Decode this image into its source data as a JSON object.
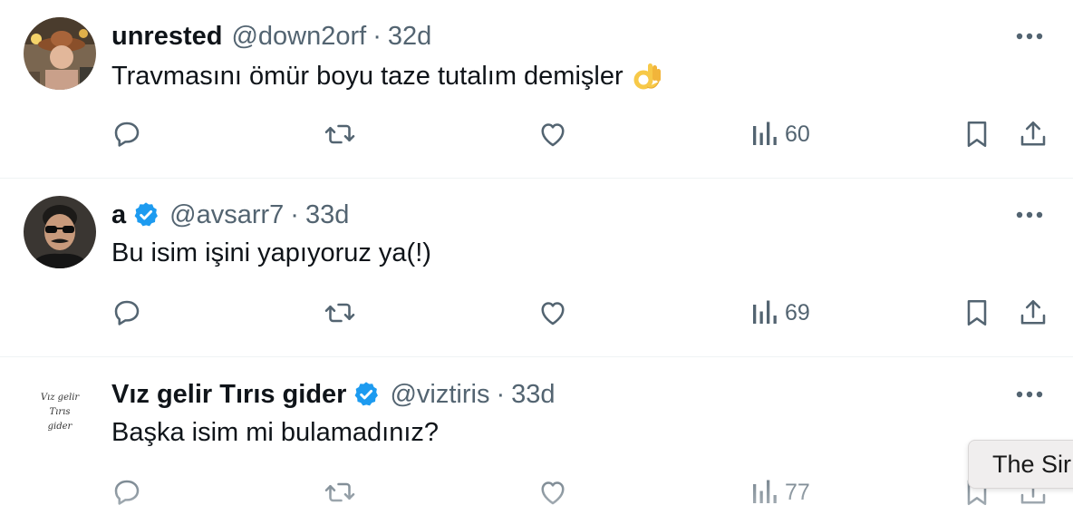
{
  "colors": {
    "text_primary": "#0f1419",
    "text_secondary": "#536471",
    "verified_blue": "#1d9bf0",
    "divider": "#eff3f4"
  },
  "tweets": [
    {
      "name": "unrested",
      "handle": "@down2orf",
      "separator": "·",
      "time": "32d",
      "text": "Travmasını ömür boyu taze tutalım demişler",
      "emoji": "ok-hand-emoji",
      "verified": false,
      "views": "60"
    },
    {
      "name": "a",
      "handle": "@avsarr7",
      "separator": "·",
      "time": "33d",
      "text": "Bu isim işini yapıyoruz ya(!)",
      "verified": true,
      "views": "69"
    },
    {
      "name": "Vız gelir Tırıs gider",
      "handle": "@viztiris",
      "separator": "·",
      "time": "33d",
      "text": "Başka isim mi bulamadınız?",
      "verified": true,
      "views": "77",
      "avatar_text": [
        "Vız gelir",
        "Tırıs",
        "gider"
      ]
    }
  ],
  "tooltip": {
    "text": "The Sir"
  }
}
